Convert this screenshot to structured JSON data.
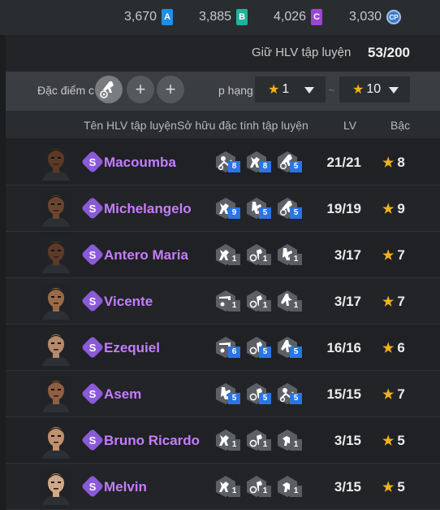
{
  "currencies": [
    {
      "value": "3,670",
      "tag": "A",
      "color": "#1f8ee8"
    },
    {
      "value": "3,885",
      "tag": "B",
      "color": "#1fb39a"
    },
    {
      "value": "4,026",
      "tag": "C",
      "color": "#9a46d6"
    },
    {
      "value": "3,030",
      "tag": "CP",
      "color": "#3c7cc4"
    }
  ],
  "hold": {
    "label": "Giữ HLV tập luyện",
    "value": "53/200"
  },
  "filter": {
    "trait_label": "Đặc điểm c",
    "rank_label": "p hạng",
    "min_rank": "1",
    "max_rank": "10",
    "separator": "~"
  },
  "columns": {
    "name": "Tên HLV tập luyện",
    "traits": "Sở hữu đặc tính tập luyện",
    "level": "LV",
    "grade": "Bậc"
  },
  "coaches": [
    {
      "name": "Macoumba",
      "level": "21/21",
      "grade": "8",
      "skin": "#5a3a26",
      "traits": [
        {
          "icon": "pass-icon",
          "lvl": "8",
          "hl": true
        },
        {
          "icon": "tackle-icon",
          "lvl": "8",
          "hl": true
        },
        {
          "icon": "dribble-icon",
          "lvl": "5",
          "hl": true
        }
      ]
    },
    {
      "name": "Michelangelo",
      "level": "19/19",
      "grade": "9",
      "skin": "#6a4530",
      "traits": [
        {
          "icon": "tackle-icon",
          "lvl": "9",
          "hl": true
        },
        {
          "icon": "shoot-icon",
          "lvl": "5",
          "hl": true
        },
        {
          "icon": "dribble-icon",
          "lvl": "5",
          "hl": true
        }
      ]
    },
    {
      "name": "Antero Maria",
      "level": "3/17",
      "grade": "7",
      "skin": "#5b3b28",
      "traits": [
        {
          "icon": "tackle-icon",
          "lvl": "1",
          "hl": false
        },
        {
          "icon": "run-icon",
          "lvl": "1",
          "hl": false
        },
        {
          "icon": "shoot-icon",
          "lvl": "1",
          "hl": false
        }
      ]
    },
    {
      "name": "Vicente",
      "level": "3/17",
      "grade": "7",
      "skin": "#9a6a48",
      "traits": [
        {
          "icon": "goal-icon",
          "lvl": "1",
          "hl": false
        },
        {
          "icon": "run-icon",
          "lvl": "1",
          "hl": false
        },
        {
          "icon": "kick-icon",
          "lvl": "1",
          "hl": false
        }
      ]
    },
    {
      "name": "Ezequiel",
      "level": "16/16",
      "grade": "6",
      "skin": "#b48a6c",
      "traits": [
        {
          "icon": "goal-icon",
          "lvl": "6",
          "hl": true
        },
        {
          "icon": "run-icon",
          "lvl": "5",
          "hl": true
        },
        {
          "icon": "kick-icon",
          "lvl": "5",
          "hl": true
        }
      ]
    },
    {
      "name": "Asem",
      "level": "15/15",
      "grade": "7",
      "skin": "#8e5f40",
      "traits": [
        {
          "icon": "shoot-icon",
          "lvl": "5",
          "hl": true
        },
        {
          "icon": "run-icon",
          "lvl": "5",
          "hl": true
        },
        {
          "icon": "pass-icon",
          "lvl": "5",
          "hl": true
        }
      ]
    },
    {
      "name": "Bruno Ricardo",
      "level": "3/15",
      "grade": "5",
      "skin": "#c09070",
      "traits": [
        {
          "icon": "tackle-icon",
          "lvl": "1",
          "hl": false
        },
        {
          "icon": "run-icon",
          "lvl": "1",
          "hl": false
        },
        {
          "icon": "header-icon",
          "lvl": "1",
          "hl": false
        }
      ]
    },
    {
      "name": "Melvin",
      "level": "3/15",
      "grade": "5",
      "skin": "#d0a888",
      "traits": [
        {
          "icon": "tackle-icon",
          "lvl": "1",
          "hl": false
        },
        {
          "icon": "run-icon",
          "lvl": "1",
          "hl": false
        },
        {
          "icon": "header-icon",
          "lvl": "1",
          "hl": false
        }
      ]
    }
  ]
}
